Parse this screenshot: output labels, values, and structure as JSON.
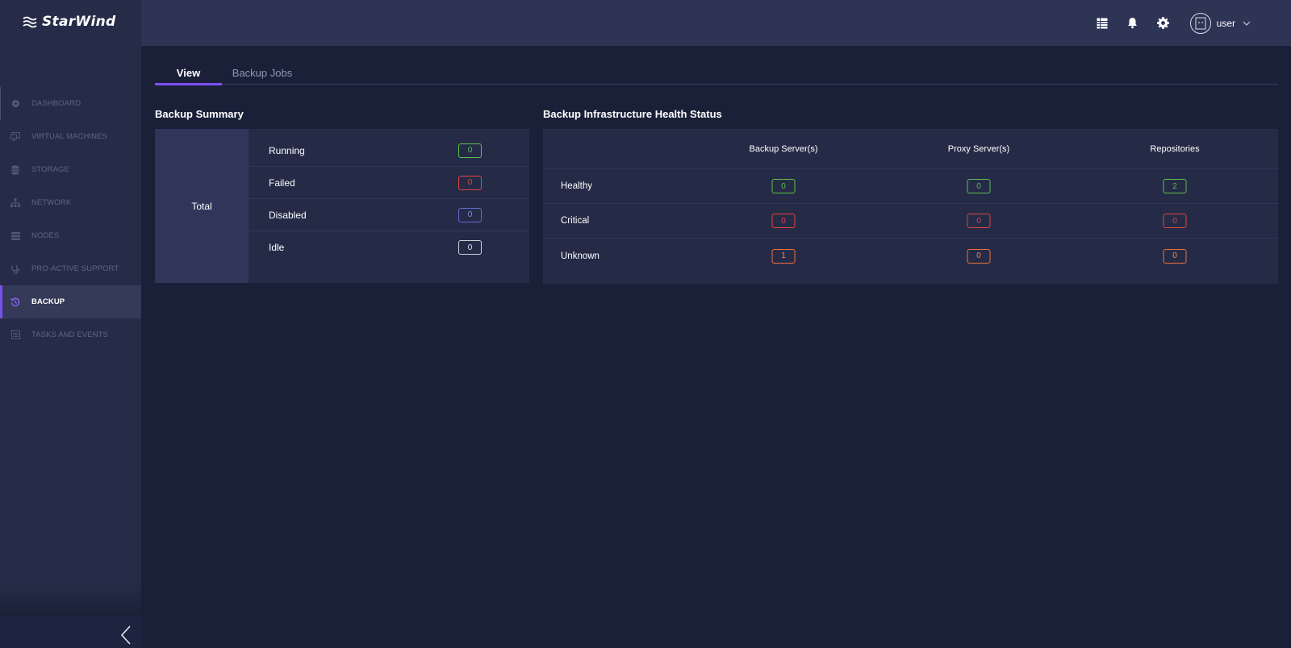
{
  "brand": {
    "name": "StarWind"
  },
  "sidebar": {
    "items": [
      {
        "label": "DASHBOARD",
        "icon": "dashboard-icon"
      },
      {
        "label": "VIRTUAL MACHINES",
        "icon": "monitor-icon"
      },
      {
        "label": "STORAGE",
        "icon": "database-icon"
      },
      {
        "label": "NETWORK",
        "icon": "network-icon"
      },
      {
        "label": "NODES",
        "icon": "server-icon"
      },
      {
        "label": "PRO-ACTIVE SUPPORT",
        "icon": "stethoscope-icon"
      },
      {
        "label": "BACKUP",
        "icon": "history-icon",
        "active": true
      },
      {
        "label": "TASKS AND EVENTS",
        "icon": "list-icon"
      }
    ],
    "collapse_icon": "chevron-left-icon"
  },
  "topbar": {
    "icons": [
      "table-icon",
      "bell-icon",
      "gear-icon"
    ],
    "user": {
      "name": "user",
      "icon": "avatar-icon"
    }
  },
  "tabs": [
    {
      "label": "View",
      "active": true
    },
    {
      "label": "Backup Jobs",
      "active": false
    }
  ],
  "summary": {
    "title": "Backup Summary",
    "total_label": "Total",
    "rows": [
      {
        "label": "Running",
        "value": "0",
        "color": "#5cbf4a"
      },
      {
        "label": "Failed",
        "value": "0",
        "color": "#e2433c"
      },
      {
        "label": "Disabled",
        "value": "0",
        "color": "#6169d2"
      },
      {
        "label": "Idle",
        "value": "0",
        "color": "#d0d2dc"
      }
    ]
  },
  "health": {
    "title": "Backup Infrastructure Health Status",
    "columns": [
      "Backup Server(s)",
      "Proxy Server(s)",
      "Repositories"
    ],
    "rows": [
      {
        "label": "Healthy",
        "values": [
          "0",
          "0",
          "2"
        ],
        "color": "#5cbf4a"
      },
      {
        "label": "Critical",
        "values": [
          "0",
          "0",
          "0"
        ],
        "color": "#e2433c"
      },
      {
        "label": "Unknown",
        "values": [
          "1",
          "0",
          "0"
        ],
        "color": "#f07038"
      }
    ]
  },
  "colors": {
    "accent": "#7a4ff0",
    "background": "#1b2039",
    "sidebar": "#262c48",
    "topbar": "#2e3454"
  }
}
